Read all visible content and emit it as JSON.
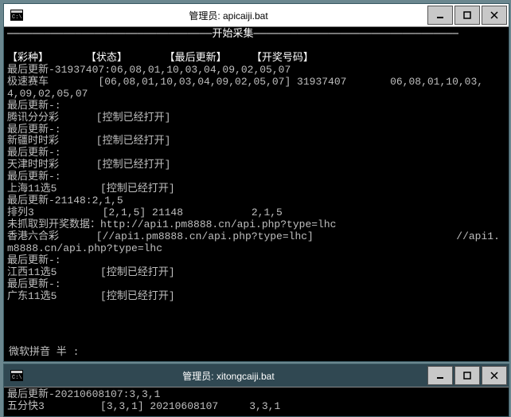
{
  "window1": {
    "title": "管理员: apicaiji.bat",
    "banner_label": "开始采集",
    "columns": {
      "c1": "【彩种】",
      "c2": "【状态】",
      "c3": "【最后更新】",
      "c4": "【开奖号码】"
    },
    "lines": {
      "l01": "最后更新-31937407:06,08,01,10,03,04,09,02,05,07",
      "l02": "极速赛车        [06,08,01,10,03,04,09,02,05,07] 31937407       06,08,01,10,03,",
      "l03": "4,09,02,05,07",
      "l04": "最后更新-:",
      "l05": "腾讯分分彩      [控制已经打开]",
      "l06": "最后更新-:",
      "l07": "新疆时时彩      [控制已经打开]",
      "l08": "最后更新-:",
      "l09": "天津时时彩      [控制已经打开]",
      "l10": "最后更新-:",
      "l11": "上海11选5       [控制已经打开]",
      "l12": "最后更新-21148:2,1,5",
      "l13": "排列3           [2,1,5] 21148           2,1,5",
      "l14": "未抓取到开奖数据：http://api1.pm8888.cn/api.php?type=lhc",
      "l15": "香港六合彩      [//api1.pm8888.cn/api.php?type=lhc]                       //api1.",
      "l16": "m8888.cn/api.php?type=lhc",
      "l17": "最后更新-:",
      "l18": "江西11选5       [控制已经打开]",
      "l19": "最后更新-:",
      "l20": "广东11选5       [控制已经打开]"
    },
    "ime_text": "微软拼音 半 :"
  },
  "window2": {
    "title": "管理员: xitongcaiji.bat",
    "lines": {
      "l01": "最后更新-20210608107:3,3,1",
      "l02": "五分快3         [3,3,1] 20210608107     3,3,1"
    }
  }
}
